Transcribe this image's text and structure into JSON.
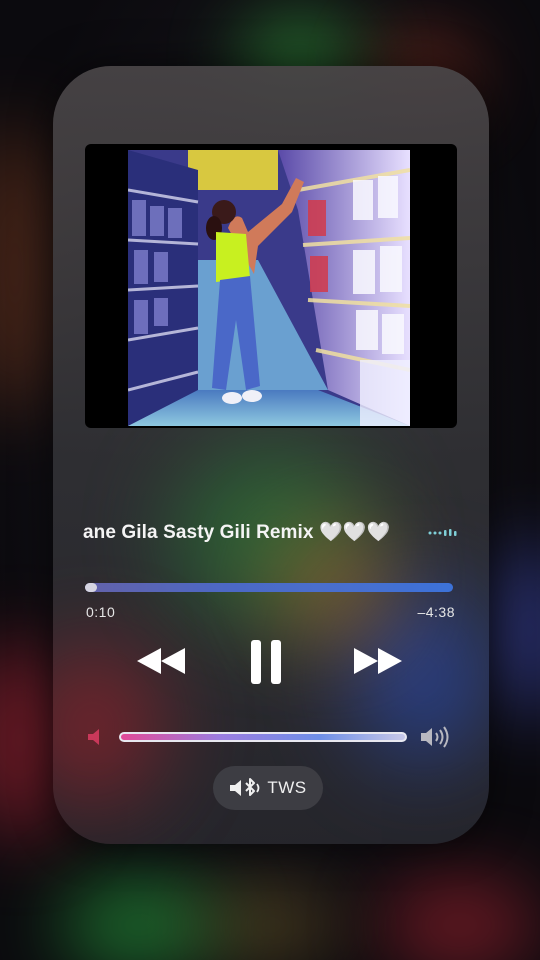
{
  "now_playing": {
    "title": "ane Gila Sasty Gili Remix 🤍🤍🤍",
    "elapsed": "0:10",
    "remaining": "–4:38",
    "progress_fraction": 0.03,
    "volume_fraction": 0.99
  },
  "controls": {
    "rewind_icon": "rewind-icon",
    "pause_icon": "pause-icon",
    "forward_icon": "fast-forward-icon",
    "volume_low_icon": "speaker-low-icon",
    "volume_high_icon": "speaker-high-icon",
    "equalizer_icon": "equalizer-icon"
  },
  "output_route": {
    "label": "TWS",
    "icon": "bluetooth-speaker-icon"
  },
  "colors": {
    "progress_fill": "#e9e8f6",
    "volume_accent_start": "#e24a98",
    "volume_accent_end": "#c8c8e8",
    "text": "#f4f4f4"
  }
}
